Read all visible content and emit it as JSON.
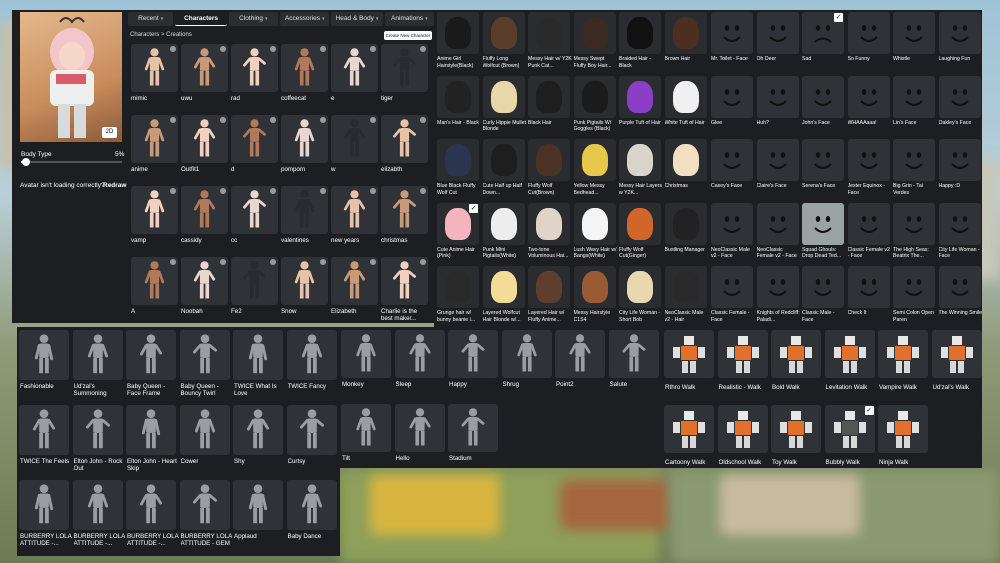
{
  "tabs": [
    {
      "label": "Recent",
      "active": false,
      "dropdown": true
    },
    {
      "label": "Characters",
      "active": true,
      "dropdown": false
    },
    {
      "label": "Clothing",
      "active": false,
      "dropdown": true
    },
    {
      "label": "Accessories",
      "active": false,
      "dropdown": true
    },
    {
      "label": "Head & Body",
      "active": false,
      "dropdown": true
    },
    {
      "label": "Animations",
      "active": false,
      "dropdown": true
    }
  ],
  "breadcrumb": "Characters > Creations",
  "create_button": "Create New Character",
  "preview": {
    "zoom_badge": "2D",
    "body_type_label": "Body Type",
    "body_type_value": "5%",
    "body_type_fraction": 0.05
  },
  "warning_text": "Avatar isn't loading correctly?",
  "redraw_label": "Redraw",
  "characters": [
    "mimic",
    "uwu",
    "rad",
    "coffeecat",
    "e",
    "tiger",
    "anime",
    "Outfit1",
    "d",
    "pompom",
    "w",
    "elizabth",
    "vamp",
    "cassidy",
    "cc",
    "valentines",
    "new years",
    "christmas",
    "A",
    "Noobah",
    "Fe2",
    "Snow",
    "Elizabeth",
    "Charlie is the best maker..."
  ],
  "hair": [
    [
      "Anime Girl Hairstyle(Black)",
      "Fluffy Long Wolfcut (Brown)",
      "Messy Hair w/ Y2K Punk Cat...",
      "Messy Swept Fluffy Boy Hair...",
      "Braided Hair - Black",
      "Brown Hair"
    ],
    [
      "Man's Hair - Black",
      "Curly Hippie Mullet Blonde",
      "Black Hair",
      "Punk Pigtails W/ Goggles (Black)",
      "Purple Tuft of Hair",
      "White Tuft of Hair"
    ],
    [
      "Blue Black Fluffy Wolf Cut",
      "Cute Half up Half Down...",
      "Fluffy Wolf Cut(Brown)",
      "Yellow Messy Bedhead...",
      "Messy Hair Layers w Y2K...",
      "Christmas"
    ],
    [
      "Cute Anime Hair (Pink)",
      "Punk Mini Pigtails(White)",
      "Two-tone Voluminous Hai...",
      "Lush Wavy Hair w/ Bangs(White)",
      "Fluffy Wolf Cut(Ginger)",
      "Bustling Manager"
    ],
    [
      "Grunge hair w/ bunny beanie i...",
      "Layered Wolfcut Hair Blonde w/...",
      "Layered Hair w/ Fluffy Anime...",
      "Messy Hairstyle C1S4",
      "City Life Woman - Short Bob",
      "NeoClassic Male v2 - Hair"
    ]
  ],
  "hair_colors": [
    [
      "#1a1a1a",
      "#5a3e2b",
      "#2a2a2a",
      "#3b2a22",
      "#111111",
      "#4a2f22"
    ],
    [
      "#222222",
      "#e8d7a8",
      "#1e1e1e",
      "#1b1b1b",
      "#8b3fc6",
      "#f0f0f0"
    ],
    [
      "#2b3550",
      "#1e1e1e",
      "#4a3226",
      "#e8c84a",
      "#d9d4cc",
      "#f1dfc4"
    ],
    [
      "#f3b4c0",
      "#ededed",
      "#e0d4c8",
      "#f5f5f5",
      "#d0662a",
      "#222222"
    ],
    [
      "#2a2a2a",
      "#f2dc98",
      "#5e3e2c",
      "#9a5a34",
      "#e8d8b0",
      "#2a2a2a"
    ]
  ],
  "faces": [
    [
      "Mr. Toilet - Face",
      "Oh Deer",
      "Sad",
      "So Funny",
      "Whistle",
      "Laughing Fun"
    ],
    [
      "Glee",
      "Huh?",
      "John's Face",
      "WHAAAaaa!",
      "Lin's Face",
      "Oakley's Face"
    ],
    [
      "Casey's Face",
      "Claire's Face",
      "Serena's Face",
      "Jester Equinox - Face",
      "Big Grin - Tai Verdes",
      "Happy :D"
    ],
    [
      "NeoClassic Male v2 - Face",
      "NeoClassic Female v2 - Face",
      "Squad Ghouls: Drop Dead Ted...",
      "Classic Female v2 - Face",
      "The High Seas: Beatrix The...",
      "City Life Woman - Face"
    ],
    [
      "Classic Female - Face",
      "Knights of Redcliff: Paladi...",
      "Classic Male - Face",
      "Check It",
      "Semi Colon Open Paren",
      "The Winning Smile"
    ]
  ],
  "emotes_left": [
    "Fashionable",
    "Ud'zal's Summoning",
    "Baby Queen - Face Frame",
    "Baby Queen - Bouncy Twirl",
    "TWICE What Is Love",
    "TWICE Fancy",
    "TWICE The Feels",
    "Elton John - Rock Out",
    "Elton John - Heart Skip",
    "Cower",
    "Shy",
    "Curtsy",
    "BURBERRY LOLA ATTITUDE -...",
    "BURBERRY LOLA ATTITUDE -...",
    "BURBERRY LOLA ATTITUDE -...",
    "BURBERRY LOLA ATTITUDE - GEM",
    "Applaud",
    "Baby Dance"
  ],
  "emotes_mid": [
    "Monkey",
    "Sleep",
    "Happy",
    "Shrug",
    "Point2",
    "Salute",
    "Tilt",
    "Hello",
    "Stadium"
  ],
  "walks": [
    "Rthro Walk",
    "Realistic - Walk",
    "Bold Walk",
    "Levitation Walk",
    "Vampire Walk",
    "Ud'zal's Walk",
    "Cartoony Walk",
    "Oldschool Walk",
    "Toy Walk",
    "Bubbly Walk",
    "Ninja Walk"
  ],
  "icons": {
    "selected": "check-icon",
    "settings": "gear-badge-icon"
  },
  "colors": {
    "panel": "#1c1e21",
    "tile": "#2f3236",
    "walk_orange": "#e0702a",
    "face_selected_bg": "#9aa3a3"
  }
}
